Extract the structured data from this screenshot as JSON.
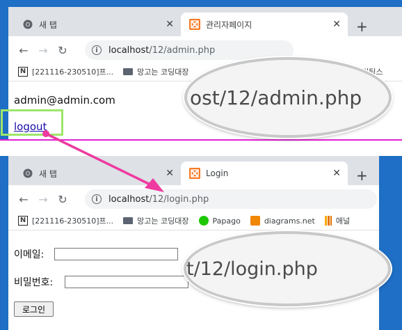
{
  "window1": {
    "tabs": [
      {
        "label": "새 탭",
        "icon": "chrome-icon"
      },
      {
        "label": "관리자페이지",
        "icon": "xampp-icon"
      }
    ],
    "url_host": "localhost",
    "url_path": "/12/admin.php",
    "bookmarks": [
      {
        "label": "[221116-230510]프...",
        "icon": "notion-icon"
      },
      {
        "label": "망고는 코딩대장",
        "icon": "monitor-icon"
      },
      {
        "label": "애널리틱스",
        "icon": "analytics-icon"
      }
    ],
    "email": "admin@admin.com",
    "logout_label": "logout",
    "magnifier_text": "ost/12/admin.php"
  },
  "window2": {
    "tabs": [
      {
        "label": "새 탭",
        "icon": "chrome-icon"
      },
      {
        "label": "Login",
        "icon": "xampp-icon"
      }
    ],
    "url_host": "localhost",
    "url_path": "/12/login.php",
    "bookmarks": [
      {
        "label": "[221116-230510]프...",
        "icon": "notion-icon"
      },
      {
        "label": "망고는 코딩대장",
        "icon": "monitor-icon"
      },
      {
        "label": "Papago",
        "icon": "papago-icon"
      },
      {
        "label": "diagrams.net",
        "icon": "diagrams-icon"
      },
      {
        "label": "애널",
        "icon": "analytics-icon"
      }
    ],
    "email_label": "이메일:",
    "password_label": "비밀번호:",
    "login_button": "로그인",
    "magnifier_text": "t/12/login.php"
  },
  "colors": {
    "highlight_box": "#9ee66a",
    "arrow": "#ee3aa0",
    "divider": "#e020d0",
    "desktop": "#1e6fc5"
  }
}
